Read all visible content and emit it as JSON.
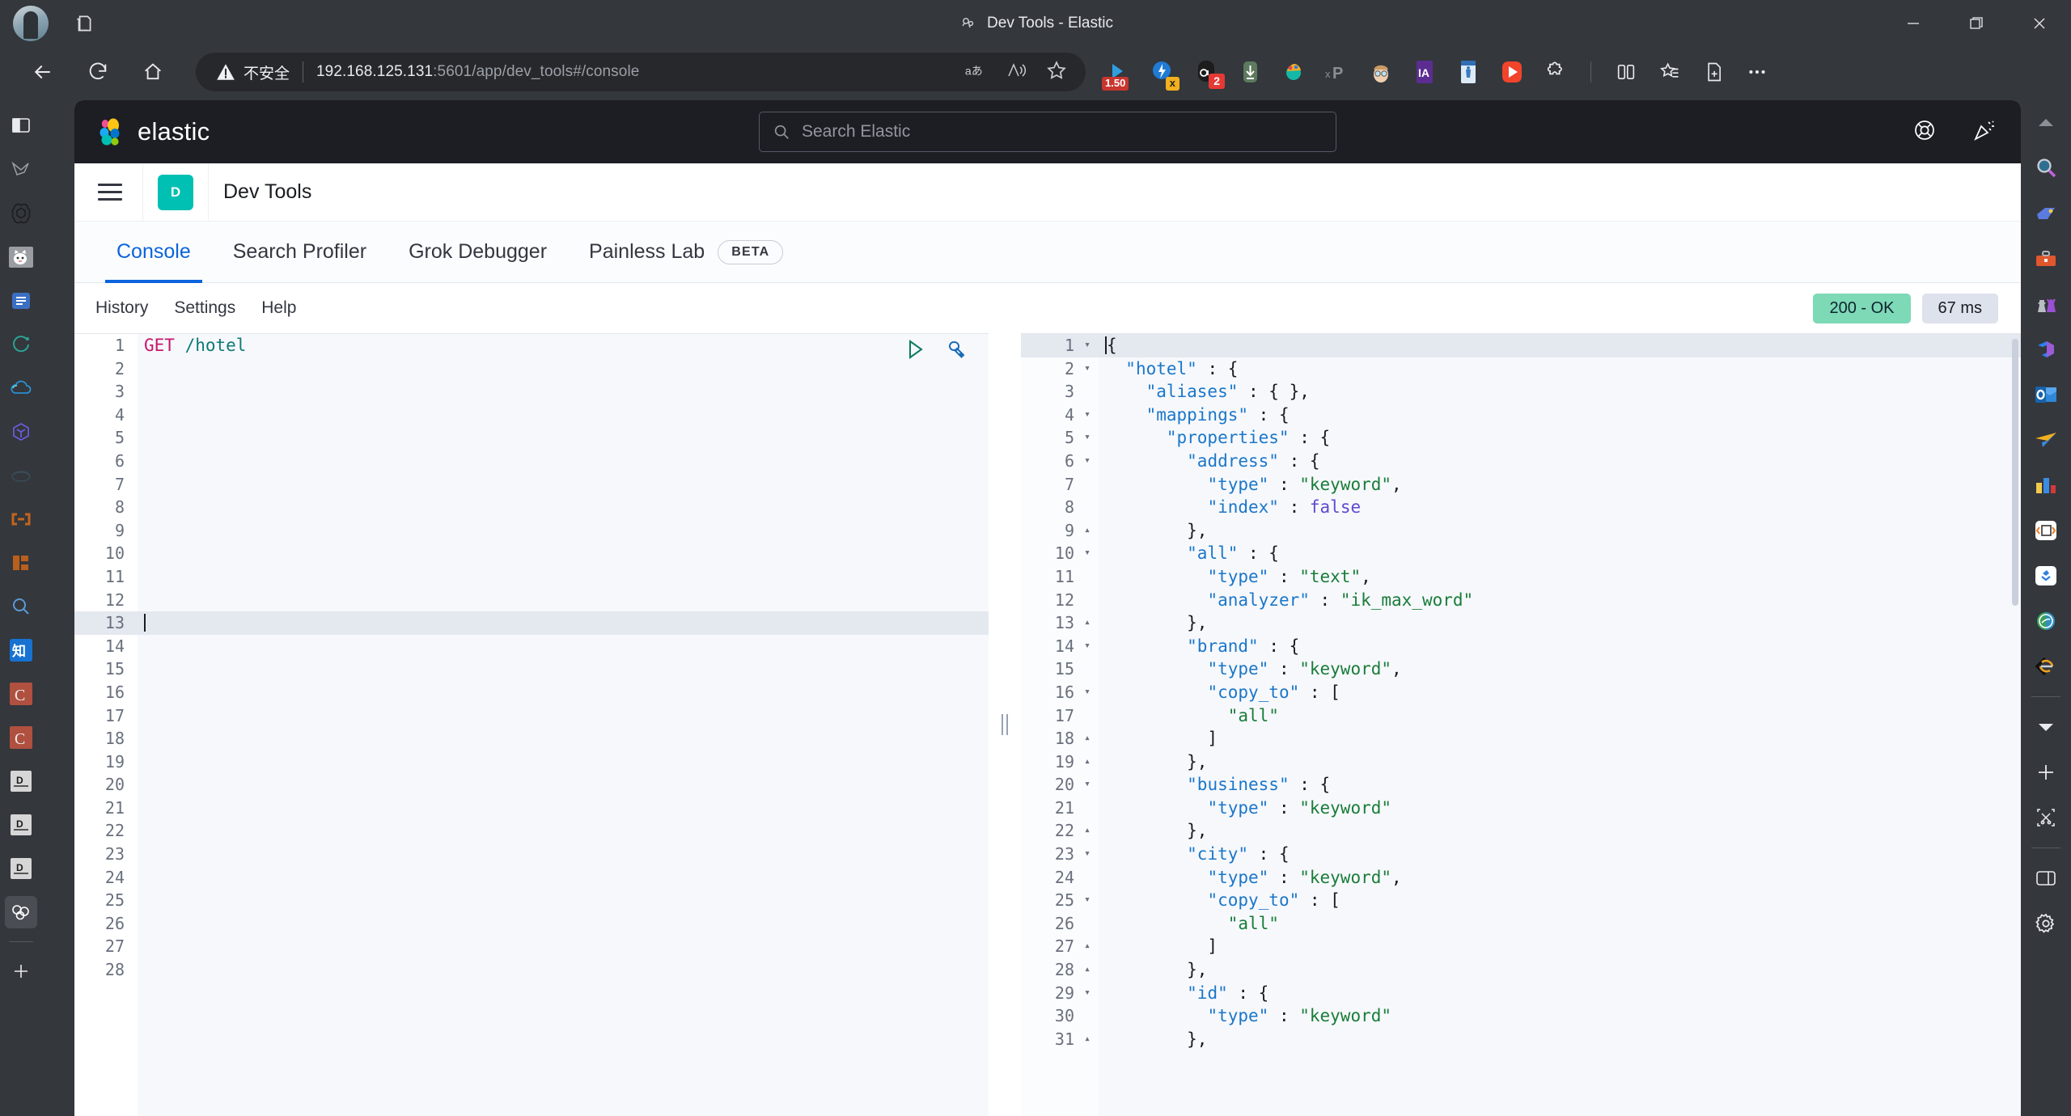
{
  "browser": {
    "window_title": "Dev Tools - Elastic",
    "security_label": "不安全",
    "url_host": "192.168.125.131",
    "url_path": ":5601/app/dev_tools#/console",
    "url_full": "192.168.125.131:5601/app/dev_tools#/console",
    "window_controls": {
      "minimize": "minimize-icon",
      "maximize": "maximize-icon",
      "close": "close-icon"
    },
    "nav": {
      "back": "back-arrow-icon",
      "reload": "reload-icon",
      "home": "home-icon"
    },
    "omnibox_icons": [
      "read-aloud-a-icon",
      "immersive-reader-icon",
      "favorite-star-icon"
    ],
    "extensions": [
      {
        "name": "speed-controller-extension",
        "badge": "1.50"
      },
      {
        "name": "lightning-extension",
        "badge": "x"
      },
      {
        "name": "video-download-extension",
        "badge": "2"
      },
      {
        "name": "download-manager-extension",
        "badge": ""
      },
      {
        "name": "colorful-palette-extension",
        "badge": ""
      },
      {
        "name": "xpath-extension",
        "badge": "xP"
      },
      {
        "name": "face-avatar-extension",
        "badge": ""
      },
      {
        "name": "ia-purple-extension",
        "badge": "IA"
      },
      {
        "name": "blue-card-extension",
        "badge": ""
      },
      {
        "name": "video-player-extension",
        "badge": ""
      },
      {
        "name": "puzzle-extensions-icon",
        "badge": ""
      },
      {
        "name": "split-screen-icon",
        "badge": ""
      },
      {
        "name": "collections-favorites-icon",
        "badge": ""
      },
      {
        "name": "add-to-collections-icon",
        "badge": ""
      },
      {
        "name": "browser-more-icon",
        "badge": ""
      }
    ],
    "left_rail": [
      "browser-essentials-icon",
      "drop-pen-icon",
      "chatgpt-icon",
      "cat-app-icon",
      "notes-blue-icon",
      "loading-ring-icon",
      "cloud-icon",
      "gem-purple-icon",
      "whale-faded-icon",
      "link-orange-icon",
      "robot-orange-icon",
      "search-blue-icon",
      "zhihu-icon",
      "c-red-icon",
      "c-red-icon-2",
      "d-doc-icon",
      "d-doc-icon-2",
      "d-doc-icon-3",
      "copilot-bubbles-icon",
      "add-tab-icon"
    ],
    "right_rail": [
      "collapse-up-icon",
      "search-magnifier-icon",
      "tag-blue-icon",
      "toolbox-icon",
      "chess-pieces-icon",
      "microsoft-365-icon",
      "outlook-icon",
      "send-plane-icon",
      "charts-bars-icon",
      "code-edit-icon",
      "juejin-icon",
      "aliyun-icon",
      "swap-arrows-icon",
      "chevron-down-icon",
      "add-plus-icon",
      "snip-screenshot-icon",
      "sidebar-panel-icon",
      "settings-gear-icon"
    ]
  },
  "kibana": {
    "brand": "elastic",
    "search": {
      "placeholder": "Search Elastic",
      "icon": "search-icon"
    },
    "header_right": [
      "help-lifebuoy-icon",
      "whats-new-icon"
    ],
    "app": {
      "menu_icon": "hamburger-menu-icon",
      "chip": "D",
      "name": "Dev Tools"
    },
    "tabs": [
      {
        "label": "Console",
        "active": true,
        "badge": ""
      },
      {
        "label": "Search Profiler",
        "active": false,
        "badge": ""
      },
      {
        "label": "Grok Debugger",
        "active": false,
        "badge": ""
      },
      {
        "label": "Painless Lab",
        "active": false,
        "badge": "BETA"
      }
    ],
    "subnav": [
      "History",
      "Settings",
      "Help"
    ],
    "status": {
      "code": "200 - OK",
      "time": "67 ms",
      "ok_color": "#7dd9b6"
    },
    "editor_actions": [
      "run-play-icon",
      "wrench-settings-icon"
    ]
  },
  "request_editor": {
    "total_lines": 28,
    "active_line": 13,
    "lines": [
      {
        "n": 1,
        "tokens": [
          {
            "t": "GET",
            "c": "m"
          },
          {
            "t": " ",
            "c": "p"
          },
          {
            "t": "/hotel",
            "c": "u"
          }
        ]
      },
      {
        "n": 2,
        "tokens": []
      },
      {
        "n": 3,
        "tokens": []
      },
      {
        "n": 4,
        "tokens": []
      },
      {
        "n": 5,
        "tokens": []
      },
      {
        "n": 6,
        "tokens": []
      },
      {
        "n": 7,
        "tokens": []
      },
      {
        "n": 8,
        "tokens": []
      },
      {
        "n": 9,
        "tokens": []
      },
      {
        "n": 10,
        "tokens": []
      },
      {
        "n": 11,
        "tokens": []
      },
      {
        "n": 12,
        "tokens": []
      },
      {
        "n": 13,
        "tokens": []
      },
      {
        "n": 14,
        "tokens": []
      },
      {
        "n": 15,
        "tokens": []
      },
      {
        "n": 16,
        "tokens": []
      },
      {
        "n": 17,
        "tokens": []
      },
      {
        "n": 18,
        "tokens": []
      },
      {
        "n": 19,
        "tokens": []
      },
      {
        "n": 20,
        "tokens": []
      },
      {
        "n": 21,
        "tokens": []
      },
      {
        "n": 22,
        "tokens": []
      },
      {
        "n": 23,
        "tokens": []
      },
      {
        "n": 24,
        "tokens": []
      },
      {
        "n": 25,
        "tokens": []
      },
      {
        "n": 26,
        "tokens": []
      },
      {
        "n": 27,
        "tokens": []
      },
      {
        "n": 28,
        "tokens": []
      }
    ]
  },
  "response_editor": {
    "active_line": 1,
    "lines": [
      {
        "n": 1,
        "fold": "down",
        "tokens": [
          {
            "t": "{",
            "c": "p"
          }
        ]
      },
      {
        "n": 2,
        "fold": "down",
        "tokens": [
          {
            "t": "  ",
            "c": "p"
          },
          {
            "t": "\"hotel\"",
            "c": "k"
          },
          {
            "t": " : {",
            "c": "p"
          }
        ]
      },
      {
        "n": 3,
        "fold": "",
        "tokens": [
          {
            "t": "    ",
            "c": "p"
          },
          {
            "t": "\"aliases\"",
            "c": "k"
          },
          {
            "t": " : { },",
            "c": "p"
          }
        ]
      },
      {
        "n": 4,
        "fold": "down",
        "tokens": [
          {
            "t": "    ",
            "c": "p"
          },
          {
            "t": "\"mappings\"",
            "c": "k"
          },
          {
            "t": " : {",
            "c": "p"
          }
        ]
      },
      {
        "n": 5,
        "fold": "down",
        "tokens": [
          {
            "t": "      ",
            "c": "p"
          },
          {
            "t": "\"properties\"",
            "c": "k"
          },
          {
            "t": " : {",
            "c": "p"
          }
        ]
      },
      {
        "n": 6,
        "fold": "down",
        "tokens": [
          {
            "t": "        ",
            "c": "p"
          },
          {
            "t": "\"address\"",
            "c": "k"
          },
          {
            "t": " : {",
            "c": "p"
          }
        ]
      },
      {
        "n": 7,
        "fold": "",
        "tokens": [
          {
            "t": "          ",
            "c": "p"
          },
          {
            "t": "\"type\"",
            "c": "k"
          },
          {
            "t": " : ",
            "c": "p"
          },
          {
            "t": "\"keyword\"",
            "c": "s"
          },
          {
            "t": ",",
            "c": "p"
          }
        ]
      },
      {
        "n": 8,
        "fold": "",
        "tokens": [
          {
            "t": "          ",
            "c": "p"
          },
          {
            "t": "\"index\"",
            "c": "k"
          },
          {
            "t": " : ",
            "c": "p"
          },
          {
            "t": "false",
            "c": "b"
          }
        ]
      },
      {
        "n": 9,
        "fold": "up",
        "tokens": [
          {
            "t": "        },",
            "c": "p"
          }
        ]
      },
      {
        "n": 10,
        "fold": "down",
        "tokens": [
          {
            "t": "        ",
            "c": "p"
          },
          {
            "t": "\"all\"",
            "c": "k"
          },
          {
            "t": " : {",
            "c": "p"
          }
        ]
      },
      {
        "n": 11,
        "fold": "",
        "tokens": [
          {
            "t": "          ",
            "c": "p"
          },
          {
            "t": "\"type\"",
            "c": "k"
          },
          {
            "t": " : ",
            "c": "p"
          },
          {
            "t": "\"text\"",
            "c": "s"
          },
          {
            "t": ",",
            "c": "p"
          }
        ]
      },
      {
        "n": 12,
        "fold": "",
        "tokens": [
          {
            "t": "          ",
            "c": "p"
          },
          {
            "t": "\"analyzer\"",
            "c": "k"
          },
          {
            "t": " : ",
            "c": "p"
          },
          {
            "t": "\"ik_max_word\"",
            "c": "s"
          }
        ]
      },
      {
        "n": 13,
        "fold": "up",
        "tokens": [
          {
            "t": "        },",
            "c": "p"
          }
        ]
      },
      {
        "n": 14,
        "fold": "down",
        "tokens": [
          {
            "t": "        ",
            "c": "p"
          },
          {
            "t": "\"brand\"",
            "c": "k"
          },
          {
            "t": " : {",
            "c": "p"
          }
        ]
      },
      {
        "n": 15,
        "fold": "",
        "tokens": [
          {
            "t": "          ",
            "c": "p"
          },
          {
            "t": "\"type\"",
            "c": "k"
          },
          {
            "t": " : ",
            "c": "p"
          },
          {
            "t": "\"keyword\"",
            "c": "s"
          },
          {
            "t": ",",
            "c": "p"
          }
        ]
      },
      {
        "n": 16,
        "fold": "down",
        "tokens": [
          {
            "t": "          ",
            "c": "p"
          },
          {
            "t": "\"copy_to\"",
            "c": "k"
          },
          {
            "t": " : [",
            "c": "p"
          }
        ]
      },
      {
        "n": 17,
        "fold": "",
        "tokens": [
          {
            "t": "            ",
            "c": "p"
          },
          {
            "t": "\"all\"",
            "c": "s"
          }
        ]
      },
      {
        "n": 18,
        "fold": "up",
        "tokens": [
          {
            "t": "          ]",
            "c": "p"
          }
        ]
      },
      {
        "n": 19,
        "fold": "up",
        "tokens": [
          {
            "t": "        },",
            "c": "p"
          }
        ]
      },
      {
        "n": 20,
        "fold": "down",
        "tokens": [
          {
            "t": "        ",
            "c": "p"
          },
          {
            "t": "\"business\"",
            "c": "k"
          },
          {
            "t": " : {",
            "c": "p"
          }
        ]
      },
      {
        "n": 21,
        "fold": "",
        "tokens": [
          {
            "t": "          ",
            "c": "p"
          },
          {
            "t": "\"type\"",
            "c": "k"
          },
          {
            "t": " : ",
            "c": "p"
          },
          {
            "t": "\"keyword\"",
            "c": "s"
          }
        ]
      },
      {
        "n": 22,
        "fold": "up",
        "tokens": [
          {
            "t": "        },",
            "c": "p"
          }
        ]
      },
      {
        "n": 23,
        "fold": "down",
        "tokens": [
          {
            "t": "        ",
            "c": "p"
          },
          {
            "t": "\"city\"",
            "c": "k"
          },
          {
            "t": " : {",
            "c": "p"
          }
        ]
      },
      {
        "n": 24,
        "fold": "",
        "tokens": [
          {
            "t": "          ",
            "c": "p"
          },
          {
            "t": "\"type\"",
            "c": "k"
          },
          {
            "t": " : ",
            "c": "p"
          },
          {
            "t": "\"keyword\"",
            "c": "s"
          },
          {
            "t": ",",
            "c": "p"
          }
        ]
      },
      {
        "n": 25,
        "fold": "down",
        "tokens": [
          {
            "t": "          ",
            "c": "p"
          },
          {
            "t": "\"copy_to\"",
            "c": "k"
          },
          {
            "t": " : [",
            "c": "p"
          }
        ]
      },
      {
        "n": 26,
        "fold": "",
        "tokens": [
          {
            "t": "            ",
            "c": "p"
          },
          {
            "t": "\"all\"",
            "c": "s"
          }
        ]
      },
      {
        "n": 27,
        "fold": "up",
        "tokens": [
          {
            "t": "          ]",
            "c": "p"
          }
        ]
      },
      {
        "n": 28,
        "fold": "up",
        "tokens": [
          {
            "t": "        },",
            "c": "p"
          }
        ]
      },
      {
        "n": 29,
        "fold": "down",
        "tokens": [
          {
            "t": "        ",
            "c": "p"
          },
          {
            "t": "\"id\"",
            "c": "k"
          },
          {
            "t": " : {",
            "c": "p"
          }
        ]
      },
      {
        "n": 30,
        "fold": "",
        "tokens": [
          {
            "t": "          ",
            "c": "p"
          },
          {
            "t": "\"type\"",
            "c": "k"
          },
          {
            "t": " : ",
            "c": "p"
          },
          {
            "t": "\"keyword\"",
            "c": "s"
          }
        ]
      },
      {
        "n": 31,
        "fold": "up",
        "tokens": [
          {
            "t": "        },",
            "c": "p"
          }
        ]
      }
    ]
  }
}
